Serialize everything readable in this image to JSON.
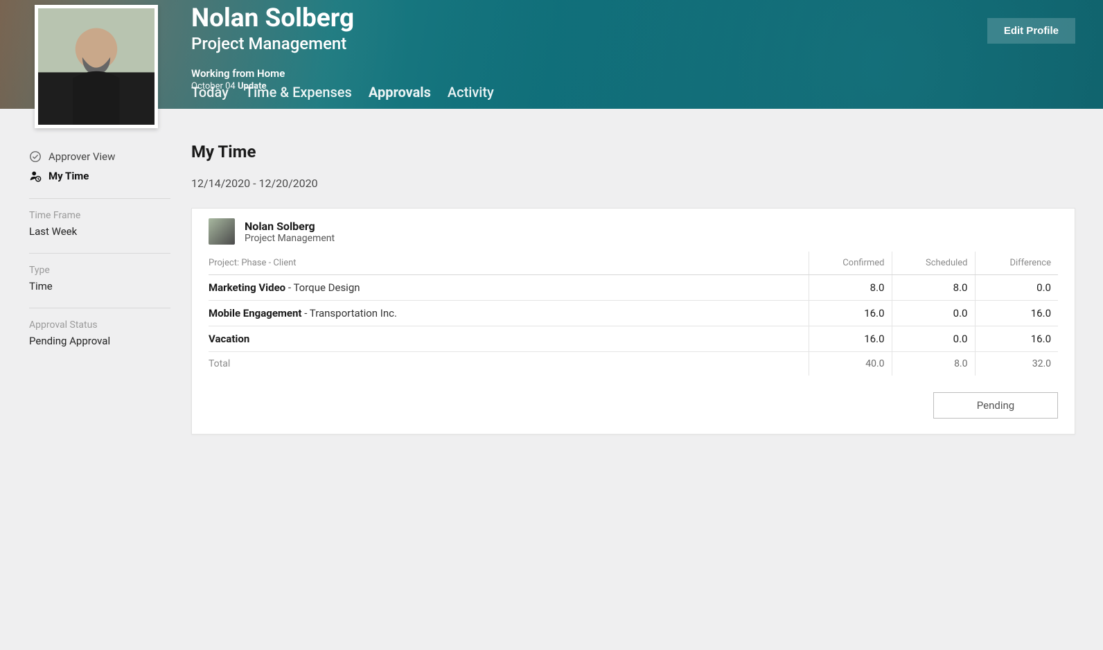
{
  "header": {
    "user_name": "Nolan Solberg",
    "user_role": "Project Management",
    "status": "Working from Home",
    "status_date": "October 04",
    "status_update": "Update",
    "edit_label": "Edit Profile",
    "tabs": [
      {
        "label": "Today"
      },
      {
        "label": "Time & Expenses"
      },
      {
        "label": "Approvals"
      },
      {
        "label": "Activity"
      }
    ]
  },
  "sidebar": {
    "views": [
      {
        "label": "Approver View"
      },
      {
        "label": "My Time"
      }
    ],
    "filters": [
      {
        "label": "Time Frame",
        "value": "Last Week"
      },
      {
        "label": "Type",
        "value": "Time"
      },
      {
        "label": "Approval Status",
        "value": "Pending Approval"
      }
    ]
  },
  "main": {
    "title": "My Time",
    "date_range": "12/14/2020 - 12/20/2020",
    "card_user_name": "Nolan Solberg",
    "card_user_role": "Project Management",
    "columns": {
      "project": "Project: Phase - Client",
      "confirmed": "Confirmed",
      "scheduled": "Scheduled",
      "difference": "Difference"
    },
    "rows": [
      {
        "project": "Marketing Video",
        "client": "Torque Design",
        "confirmed": "8.0",
        "scheduled": "8.0",
        "difference": "0.0"
      },
      {
        "project": "Mobile Engagement",
        "client": "Transportation Inc.",
        "confirmed": "16.0",
        "scheduled": "0.0",
        "difference": "16.0"
      },
      {
        "project": "Vacation",
        "client": "",
        "confirmed": "16.0",
        "scheduled": "0.0",
        "difference": "16.0"
      }
    ],
    "total": {
      "label": "Total",
      "confirmed": "40.0",
      "scheduled": "8.0",
      "difference": "32.0"
    },
    "pending_label": "Pending"
  }
}
